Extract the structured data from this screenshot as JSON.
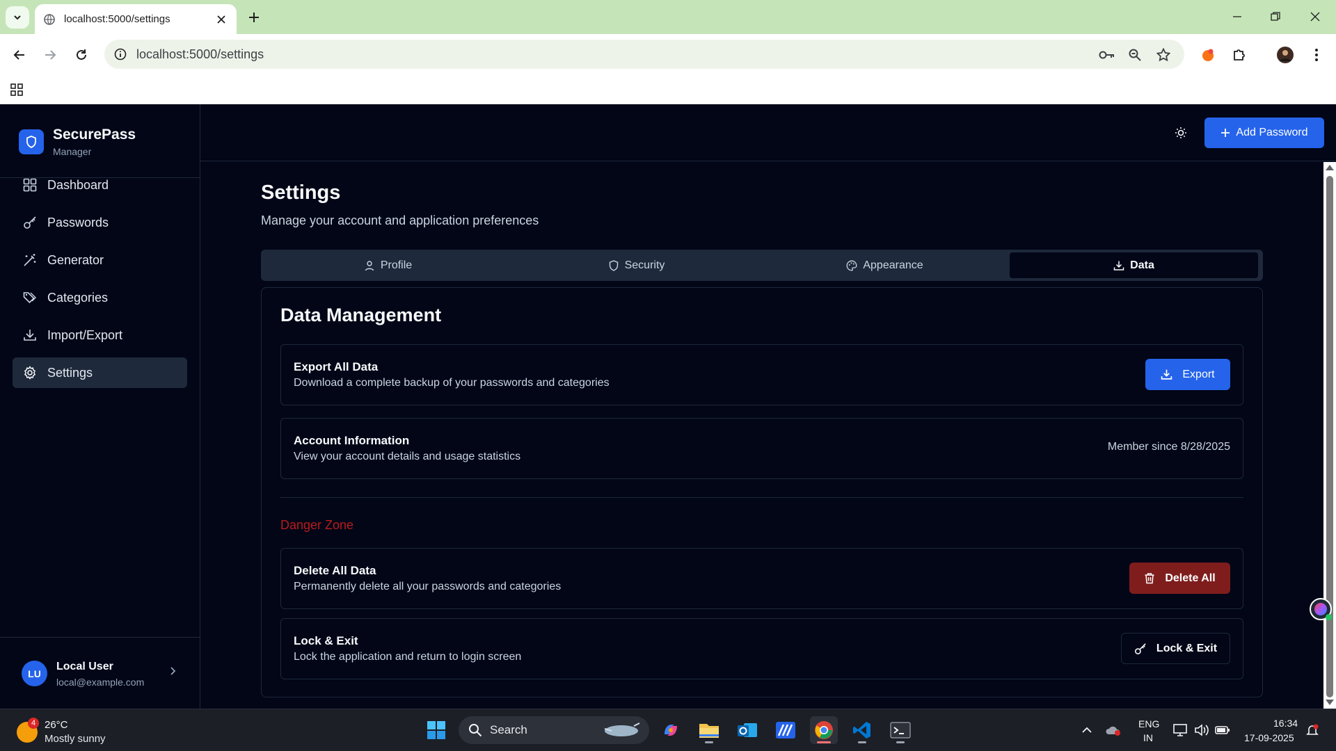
{
  "browser": {
    "tab_title": "localhost:5000/settings",
    "url": "localhost:5000/settings"
  },
  "app": {
    "brand_name": "SecurePass",
    "brand_sub": "Manager",
    "nav": [
      {
        "label": "Dashboard",
        "icon": "grid-icon"
      },
      {
        "label": "Passwords",
        "icon": "key-icon"
      },
      {
        "label": "Generator",
        "icon": "wand-icon"
      },
      {
        "label": "Categories",
        "icon": "tags-icon"
      },
      {
        "label": "Import/Export",
        "icon": "download-icon"
      },
      {
        "label": "Settings",
        "icon": "gear-icon",
        "active": true
      }
    ],
    "user": {
      "initials": "LU",
      "name": "Local User",
      "email": "local@example.com"
    },
    "add_password_label": "Add Password",
    "accent_color": "#2563eb",
    "danger_color": "#b91c1c"
  },
  "settings": {
    "title": "Settings",
    "subtitle": "Manage your account and application preferences",
    "tabs": [
      {
        "label": "Profile",
        "icon": "user-icon"
      },
      {
        "label": "Security",
        "icon": "shield-icon"
      },
      {
        "label": "Appearance",
        "icon": "palette-icon"
      },
      {
        "label": "Data",
        "icon": "download-icon",
        "active": true
      }
    ],
    "card_title": "Data Management",
    "export": {
      "title": "Export All Data",
      "desc": "Download a complete backup of your passwords and categories",
      "button": "Export"
    },
    "account": {
      "title": "Account Information",
      "desc": "View your account details and usage statistics",
      "meta": "Member since 8/28/2025"
    },
    "danger_zone": "Danger Zone",
    "delete": {
      "title": "Delete All Data",
      "desc": "Permanently delete all your passwords and categories",
      "button": "Delete All"
    },
    "lock": {
      "title": "Lock & Exit",
      "desc": "Lock the application and return to login screen",
      "button": "Lock & Exit"
    }
  },
  "taskbar": {
    "weather_badge": "4",
    "temp": "26°C",
    "weather": "Mostly sunny",
    "search": "Search",
    "lang1": "ENG",
    "lang2": "IN",
    "time": "16:34",
    "date": "17-09-2025"
  }
}
